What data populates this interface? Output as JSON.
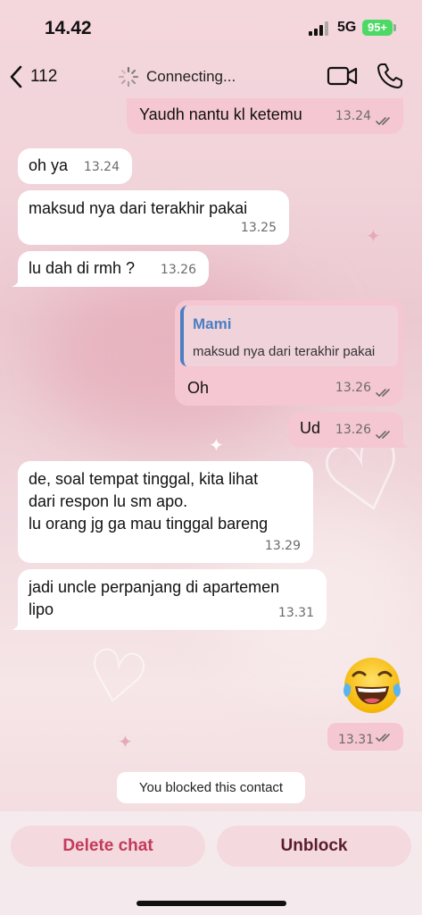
{
  "status_bar": {
    "time": "14.42",
    "network": "5G",
    "battery": "95+"
  },
  "header": {
    "back_count": "112",
    "connection_status": "Connecting...",
    "icons": [
      "back-chevron-icon",
      "loading-spinner-icon",
      "video-call-icon",
      "phone-call-icon"
    ]
  },
  "messages": [
    {
      "dir": "out",
      "text": "Yaudh nantu kl ketemu",
      "time": "13.24",
      "read": true
    },
    {
      "dir": "in",
      "text": "oh ya",
      "time": "13.24"
    },
    {
      "dir": "in",
      "text": "maksud nya dari terakhir pakai",
      "time": "13.25"
    },
    {
      "dir": "in",
      "text": "lu dah di rmh ?",
      "time": "13.26"
    },
    {
      "dir": "out",
      "reply_to": {
        "name": "Mami",
        "text": "maksud nya dari terakhir pakai"
      },
      "text": "Oh",
      "time": "13.26",
      "read": true
    },
    {
      "dir": "out",
      "text": "Ud",
      "time": "13.26",
      "read": true
    },
    {
      "dir": "in",
      "lines": [
        "de, soal tempat tinggal, kita lihat",
        "dari respon lu sm apo.",
        "lu orang jg ga mau tinggal bareng"
      ],
      "time": "13.29"
    },
    {
      "dir": "in",
      "lines": [
        "jadi uncle perpanjang di apartemen",
        "lipo"
      ],
      "time": "13.31"
    },
    {
      "dir": "out",
      "emoji": "face-with-tears-of-joy",
      "time": "13.31",
      "read": true
    }
  ],
  "system_notice": "You blocked this contact",
  "actions": {
    "delete_label": "Delete chat",
    "unblock_label": "Unblock"
  },
  "colors": {
    "outgoing_bubble": "#f5c7d2",
    "incoming_bubble": "#ffffff",
    "delete_text": "#c43a5a",
    "unblock_text": "#5b1c30",
    "reply_accent": "#4b7fc1"
  }
}
